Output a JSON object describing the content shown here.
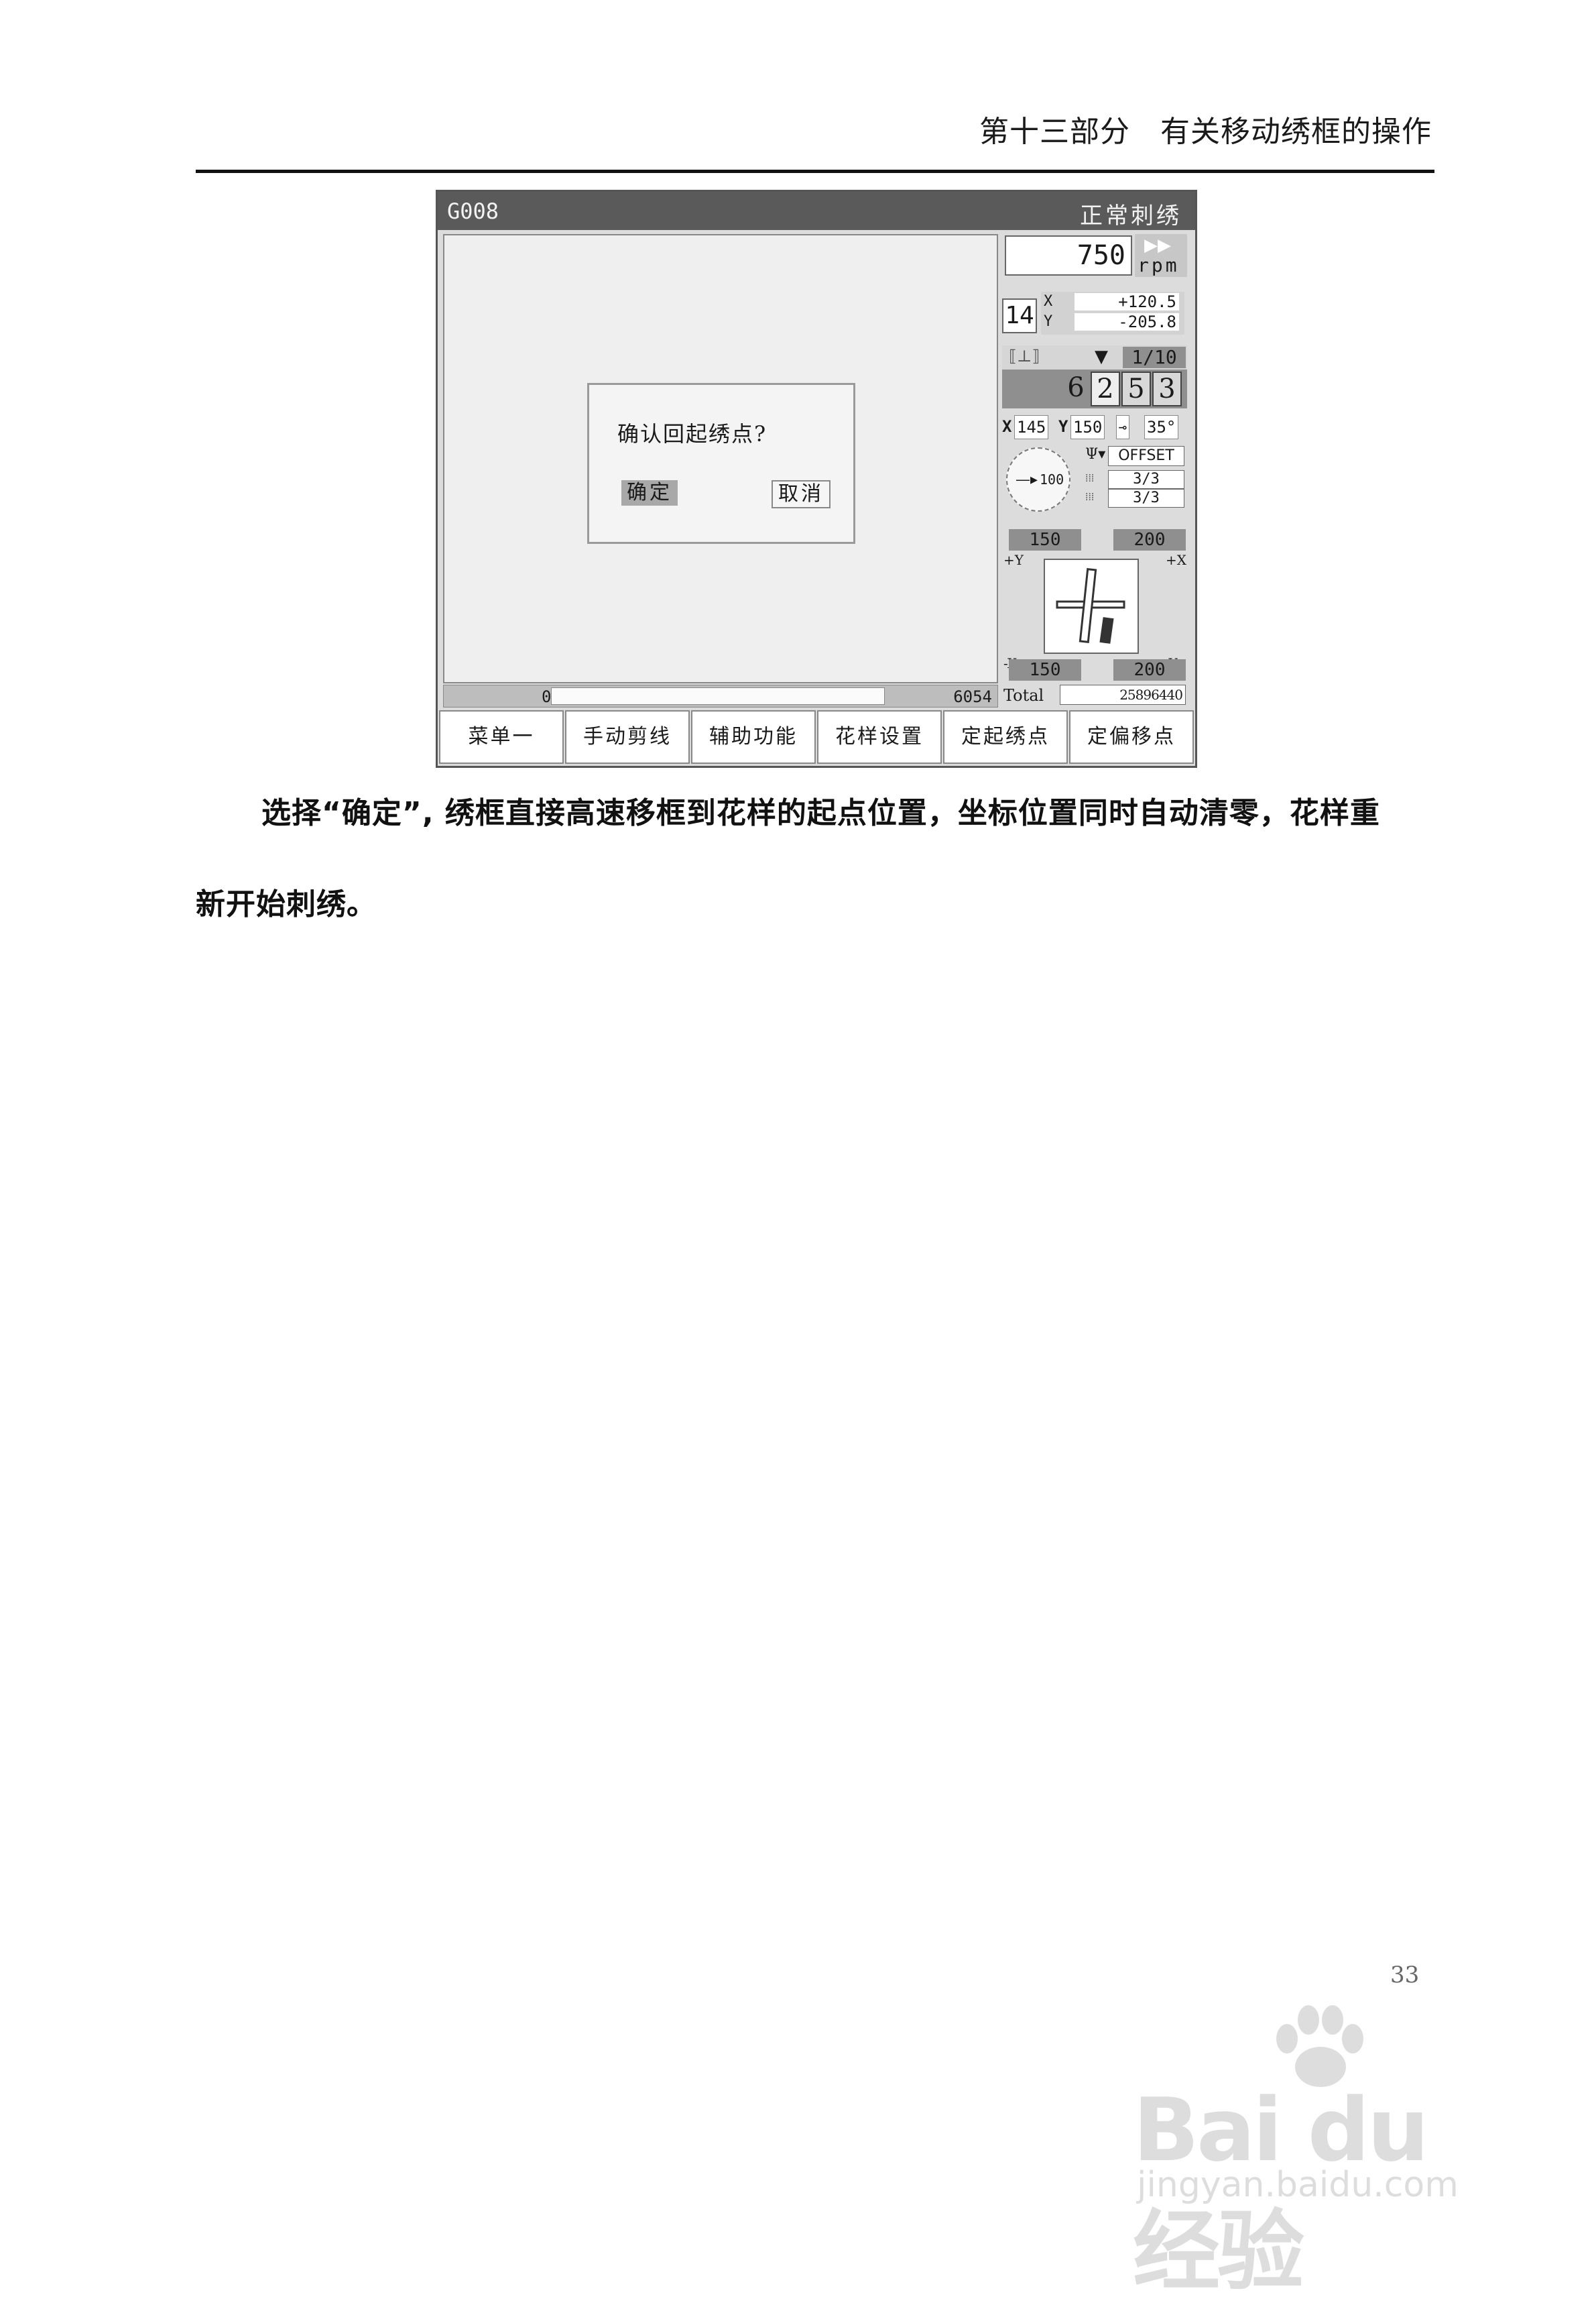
{
  "header": {
    "title": "第十三部分　有关移动绣框的操作"
  },
  "screen": {
    "pattern_code": "G008",
    "mode": "正常刺绣",
    "dialog": {
      "message": "确认回起绣点?",
      "ok_label": "确定",
      "cancel_label": "取消"
    },
    "progress": {
      "start": "0",
      "end": "6054"
    },
    "speed": {
      "value": "750",
      "unit": "rpm",
      "icon": "fast-forward-icon"
    },
    "needle": "14",
    "coords": {
      "x_label": "X",
      "x_value": "+120.5",
      "y_label": "Y",
      "y_value": "-205.8"
    },
    "stitch_strip": {
      "icon": "presser-foot-icon",
      "marker": "▼",
      "fraction": "1/10"
    },
    "color_digits": [
      "6",
      "2",
      "5",
      "3"
    ],
    "params": {
      "x_label": "X",
      "x_value": "145",
      "y_label": "Y",
      "y_value": "150",
      "angle_icon": "rotate-icon",
      "angle_value": "35°"
    },
    "dial_value": "100",
    "offset_label": "OFFSET",
    "ratio_x": "3/3",
    "ratio_y": "3/3",
    "limits": {
      "top_left": "150",
      "top_right": "200",
      "bottom_left": "150",
      "bottom_right": "200",
      "plus_y": "+Y",
      "plus_x": "+X",
      "minus_x": "-X",
      "minus_y": "-Y"
    },
    "total_label": "Total",
    "total_value": "25896440",
    "menu": [
      "菜单一",
      "手动剪线",
      "辅助功能",
      "花样设置",
      "定起绣点",
      "定偏移点"
    ]
  },
  "body": {
    "paragraph_1": "选择“确定”, 绣框直接高速移框到花样的起点位置，坐标位置同时自动清零，花样重",
    "paragraph_2": "新开始刺绣。"
  },
  "page_number": "33",
  "watermark": {
    "logo_text": "Bai du 经验",
    "url": "jingyan.baidu.com"
  }
}
